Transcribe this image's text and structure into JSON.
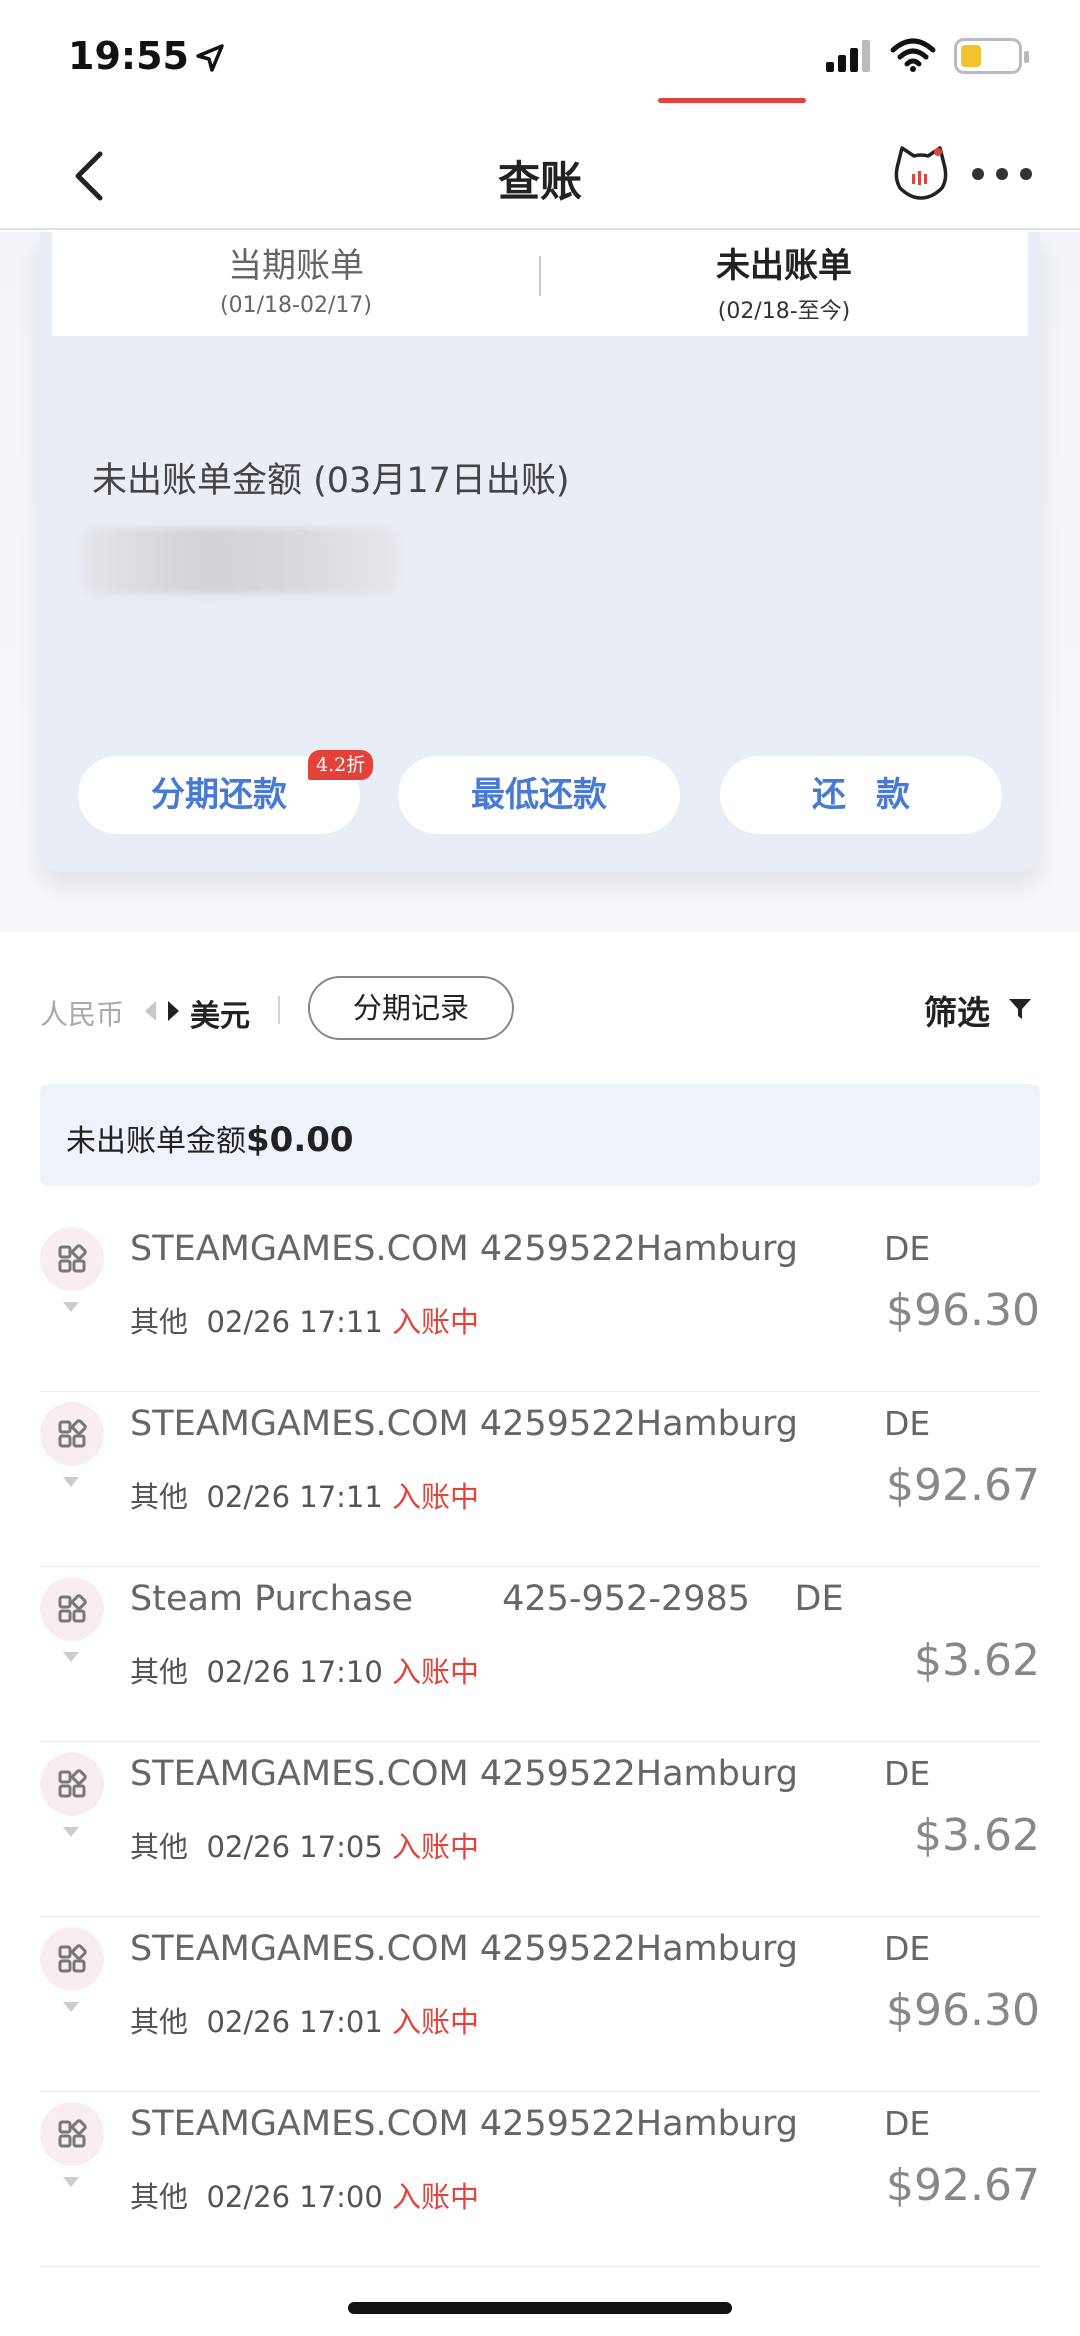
{
  "status_bar": {
    "time": "19:55"
  },
  "nav": {
    "title": "查账"
  },
  "tabs": [
    {
      "label": "当期账单",
      "range": "(01/18-02/17)"
    },
    {
      "label": "未出账单",
      "range": "(02/18-至今)"
    }
  ],
  "summary": {
    "amount_label": "未出账单金额 (03月17日出账)"
  },
  "actions": {
    "installment": "分期还款",
    "discount_badge": "4.2折",
    "minimum": "最低还款",
    "repay": "还款"
  },
  "currency": {
    "rmb": "人民币",
    "usd": "美元"
  },
  "toolbar": {
    "installment_records": "分期记录",
    "filter": "筛选"
  },
  "unbilled": {
    "label": "未出账单金额",
    "value": "$0.00"
  },
  "transactions": [
    {
      "merchant": "STEAMGAMES.COM 4259522Hamburg",
      "country": "DE",
      "category": "其他",
      "time": "02/26 17:11",
      "status": "入账中",
      "amount": "$96.30"
    },
    {
      "merchant": "STEAMGAMES.COM 4259522Hamburg",
      "country": "DE",
      "category": "其他",
      "time": "02/26 17:11",
      "status": "入账中",
      "amount": "$92.67"
    },
    {
      "merchant": "Steam Purchase        425-952-2985    DE",
      "country": "",
      "category": "其他",
      "time": "02/26 17:10",
      "status": "入账中",
      "amount": "$3.62"
    },
    {
      "merchant": "STEAMGAMES.COM 4259522Hamburg",
      "country": "DE",
      "category": "其他",
      "time": "02/26 17:05",
      "status": "入账中",
      "amount": "$3.62"
    },
    {
      "merchant": "STEAMGAMES.COM 4259522Hamburg",
      "country": "DE",
      "category": "其他",
      "time": "02/26 17:01",
      "status": "入账中",
      "amount": "$96.30"
    },
    {
      "merchant": "STEAMGAMES.COM 4259522Hamburg",
      "country": "DE",
      "category": "其他",
      "time": "02/26 17:00",
      "status": "入账中",
      "amount": "$92.67"
    }
  ],
  "colors": {
    "accent_blue": "#4779d6",
    "accent_red": "#e0453b",
    "card_bg": "#e9edf6"
  }
}
